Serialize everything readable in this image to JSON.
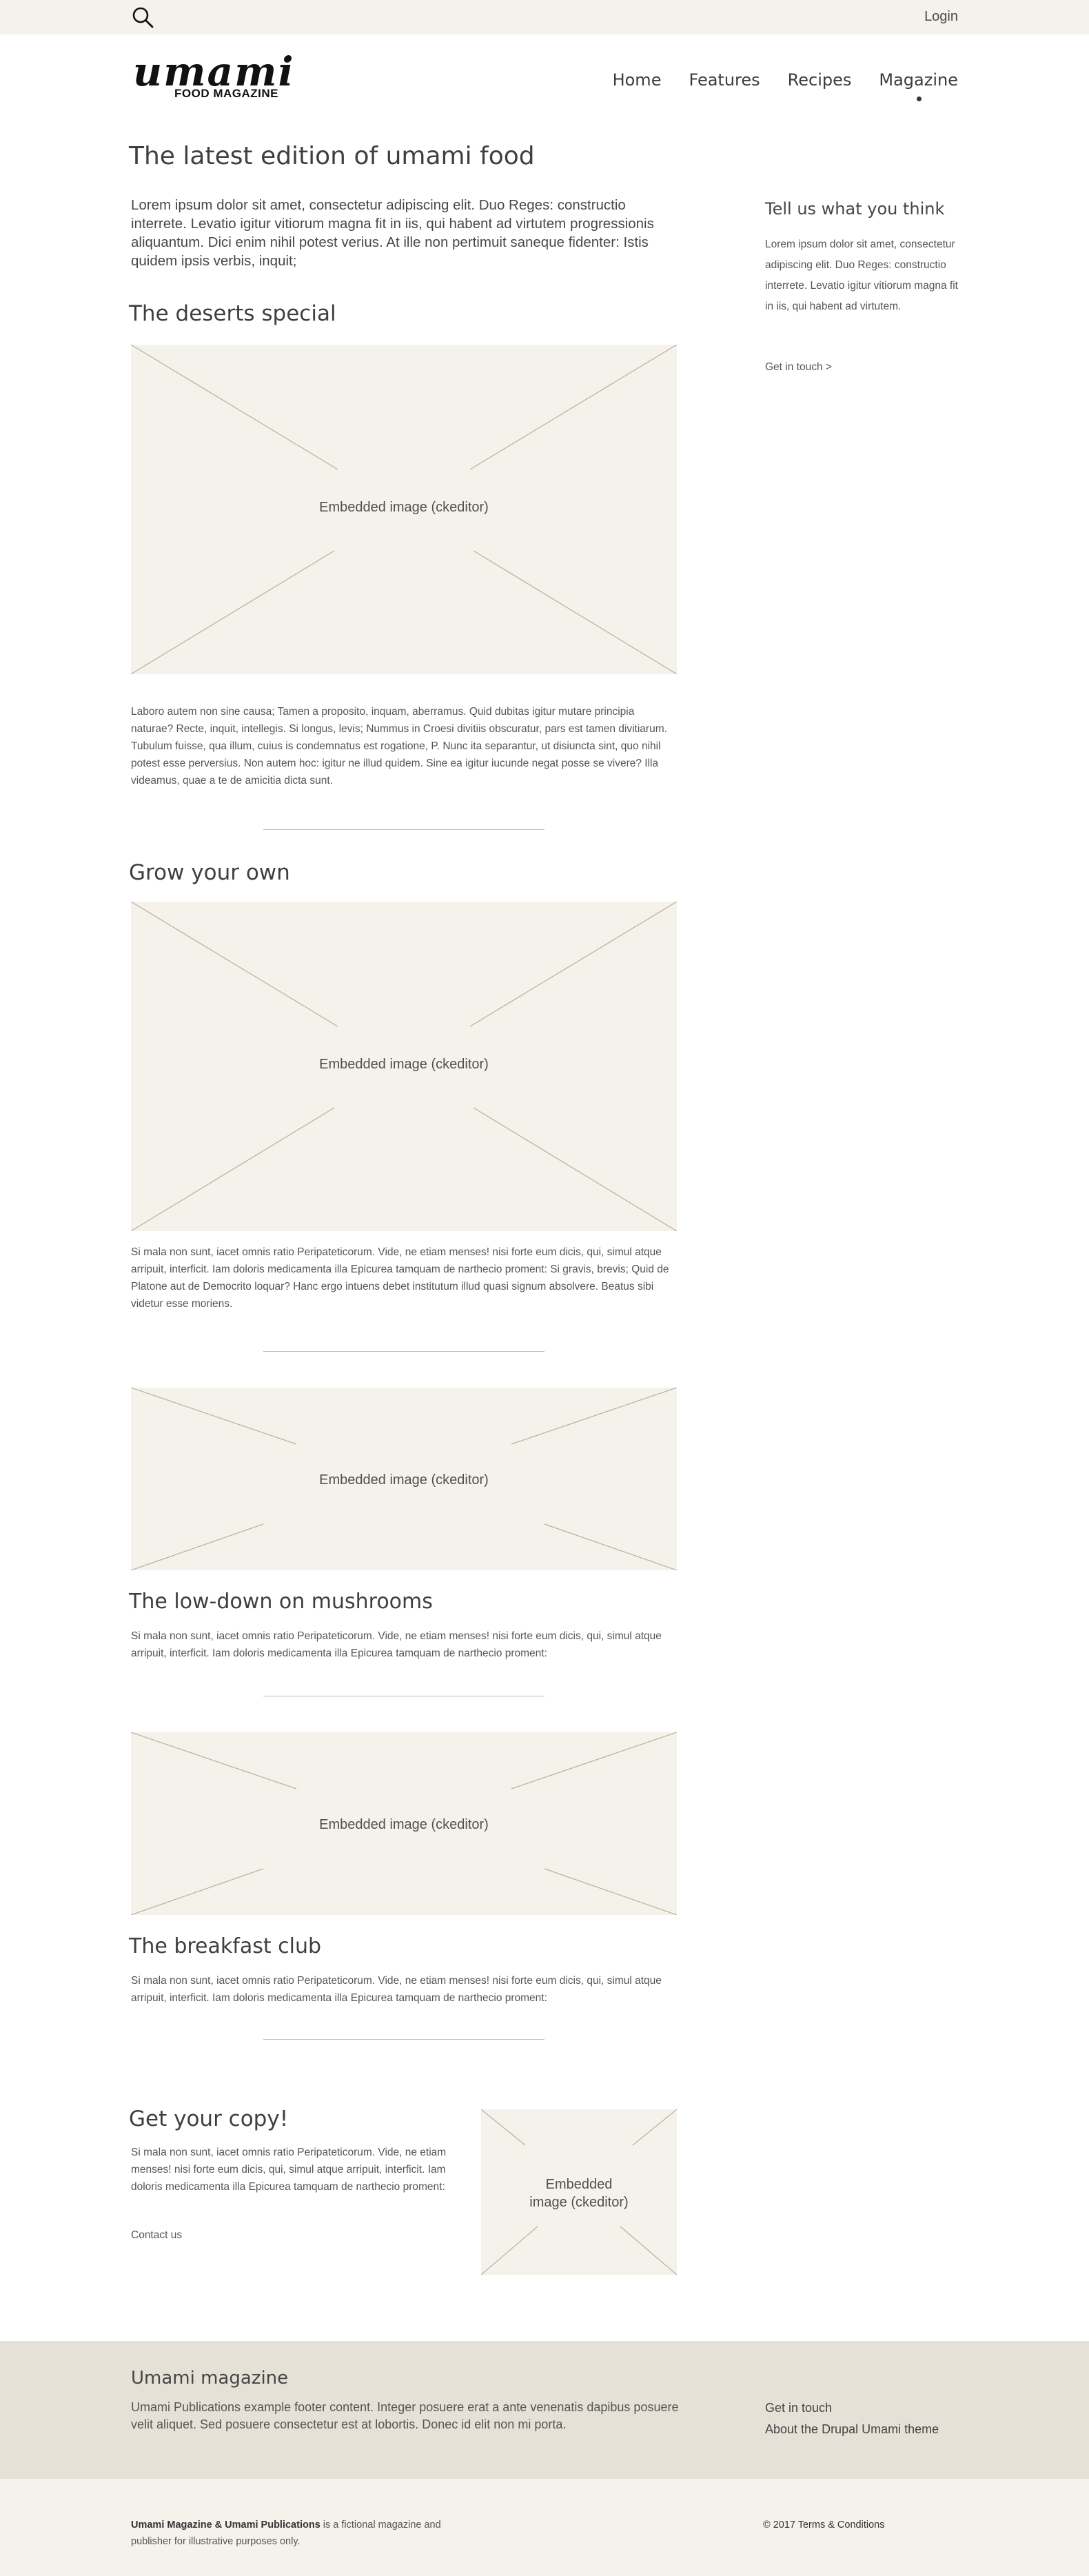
{
  "topbar": {
    "login_label": "Login",
    "search_icon": "search-icon"
  },
  "logo": {
    "word": "umami",
    "subtitle": "FOOD MAGAZINE"
  },
  "nav": {
    "items": [
      "Home",
      "Features",
      "Recipes",
      "Magazine"
    ],
    "active": "Magazine"
  },
  "main": {
    "title": "The latest edition of umami food",
    "lead": "Lorem ipsum dolor sit amet, consectetur adipiscing elit. Duo Reges: constructio interrete. Levatio igitur vitiorum magna fit in iis, qui habent ad virtutem progressionis aliquantum. Dici enim nihil potest verius. At ille non pertimuit saneque fidenter: Istis quidem ipsis verbis, inquit;",
    "image_caption": "Embedded image (ckeditor)",
    "sections": [
      {
        "heading": "The deserts special",
        "text": "Laboro autem non sine causa; Tamen a proposito, inquam, aberramus. Quid dubitas igitur mutare principia naturae? Recte, inquit, intellegis. Si longus, levis; Nummus in Croesi divitiis obscuratur, pars est tamen divitiarum. Tubulum fuisse, qua illum, cuius is condemnatus est rogatione, P. Nunc ita separantur, ut disiuncta sint, quo nihil potest esse perversius. Non autem hoc: igitur ne illud quidem. Sine ea igitur iucunde negat posse se vivere? Illa videamus, quae a te de amicitia dicta sunt."
      },
      {
        "heading": "Grow your own",
        "text": "Si mala non sunt, iacet omnis ratio Peripateticorum. Vide, ne etiam menses! nisi forte eum dicis, qui, simul atque arripuit, interficit. Iam doloris medicamenta illa Epicurea tamquam de narthecio proment: Si gravis, brevis; Quid de Platone aut de Democrito loquar? Hanc ergo intuens debet institutum illud quasi signum absolvere. Beatus sibi videtur esse moriens."
      },
      {
        "heading": "The low-down on mushrooms",
        "text": "Si mala non sunt, iacet omnis ratio Peripateticorum. Vide, ne etiam menses! nisi forte eum dicis, qui, simul atque arripuit, interficit. Iam doloris medicamenta illa Epicurea tamquam de narthecio proment:"
      },
      {
        "heading": "The breakfast club",
        "text": "Si mala non sunt, iacet omnis ratio Peripateticorum. Vide, ne etiam menses! nisi forte eum dicis, qui, simul atque arripuit, interficit. Iam doloris medicamenta illa Epicurea tamquam de narthecio proment:"
      }
    ],
    "copy": {
      "heading": "Get your copy!",
      "text": "Si mala non sunt, iacet omnis ratio Peripateticorum. Vide, ne etiam menses! nisi forte eum dicis, qui, simul atque arripuit, interficit. Iam doloris medicamenta illa Epicurea tamquam de narthecio proment:",
      "link": "Contact us",
      "image_caption_line1": "Embedded",
      "image_caption_line2": "image (ckeditor)"
    }
  },
  "sidebar": {
    "heading": "Tell us what you think",
    "text": "Lorem ipsum dolor sit amet, consectetur adipiscing elit. Duo Reges: constructio interrete. Levatio igitur vitiorum magna fit in iis, qui habent ad virtutem.",
    "link": "Get in touch >"
  },
  "footer": {
    "heading": "Umami magazine",
    "text": "Umami Publications example footer content. Integer posuere erat a ante venenatis dapibus posuere velit aliquet. Sed posuere consectetur est at lobortis. Donec id elit non mi porta.",
    "links": [
      "Get in touch",
      "About the Drupal Umami theme"
    ]
  },
  "bottom": {
    "publisher_bold": "Umami Magazine & Umami Publications",
    "publisher_rest": " is a fictional magazine and publisher for illustrative purposes only.",
    "copyright": "© 2017 Terms & Conditions"
  },
  "colors": {
    "topbar_bg": "#f4f2ea",
    "footer_bg": "#e6e1d6",
    "placeholder_bg": "#f4f2ea"
  }
}
